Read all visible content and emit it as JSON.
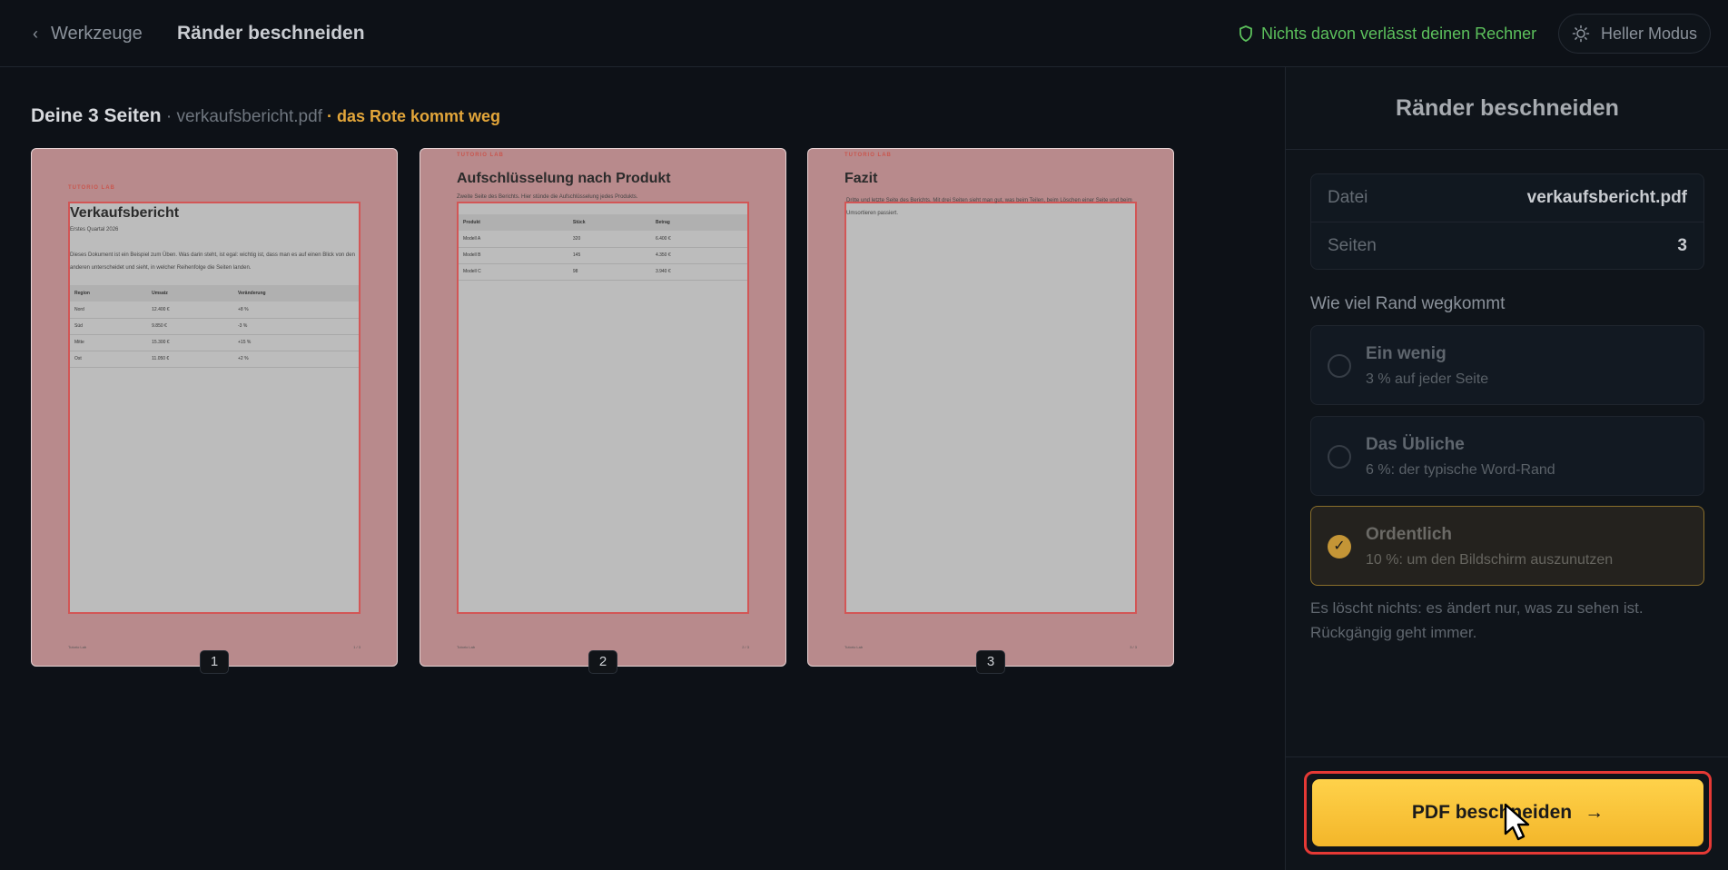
{
  "header": {
    "back_label": "Werkzeuge",
    "title": "Ränder beschneiden",
    "privacy_note": "Nichts davon verlässt deinen Rechner",
    "light_mode_label": "Heller Modus"
  },
  "pages_section": {
    "title": "Deine 3 Seiten",
    "file_part": " · verkaufsbericht.pdf",
    "warning_part": " · das Rote kommt weg"
  },
  "pages": [
    {
      "number": "1",
      "label_top": "TUTORIO LAB",
      "heading": "Verkaufsbericht",
      "sub": "Erstes Quartal 2026",
      "text": "Dieses Dokument ist ein Beispiel zum Üben. Was darin steht, ist egal: wichtig ist, dass man es auf einen Blick von den anderen unterscheidet und sieht, in welcher Reihenfolge die Seiten landen.",
      "table_headers": [
        "Region",
        "Umsatz",
        "Veränderung"
      ],
      "table_rows": [
        [
          "Nord",
          "12.400 €",
          "+8 %"
        ],
        [
          "Süd",
          "9.850 €",
          "-3 %"
        ],
        [
          "Mitte",
          "15.300 €",
          "+15 %"
        ],
        [
          "Ost",
          "11.050 €",
          "+2 %"
        ]
      ],
      "foot_left": "Tutorio Lab",
      "foot_right": "1 / 3"
    },
    {
      "number": "2",
      "label_top": "TUTORIO LAB",
      "heading": "Aufschlüsselung nach Produkt",
      "sub": "Zweite Seite des Berichts. Hier stünde die Aufschlüsselung jedes Produkts.",
      "table_headers": [
        "Produkt",
        "Stück",
        "Betrag"
      ],
      "table_rows": [
        [
          "Modell A",
          "320",
          "6.400 €"
        ],
        [
          "Modell B",
          "145",
          "4.350 €"
        ],
        [
          "Modell C",
          "98",
          "3.940 €"
        ]
      ],
      "foot_left": "Tutorio Lab",
      "foot_right": "2 / 3"
    },
    {
      "number": "3",
      "label_top": "TUTORIO LAB",
      "heading": "Fazit",
      "sub": "Dritte und letzte Seite des Berichts. Mit drei Seiten sieht man gut, was beim Teilen, beim Löschen einer Seite und beim Umsortieren passiert.",
      "foot_left": "Tutorio Lab",
      "foot_right": "3 / 3"
    }
  ],
  "panel": {
    "title": "Ränder beschneiden",
    "file_key": "Datei",
    "file_value": "verkaufsbericht.pdf",
    "pages_key": "Seiten",
    "pages_value": "3",
    "section_label": "Wie viel Rand wegkommt",
    "options": [
      {
        "title": "Ein wenig",
        "desc": "3 % auf jeder Seite",
        "selected": false
      },
      {
        "title": "Das Übliche",
        "desc": "6 %: der typische Word-Rand",
        "selected": false
      },
      {
        "title": "Ordentlich",
        "desc": "10 %: um den Bildschirm auszunutzen",
        "selected": true
      }
    ],
    "note": "Es löscht nichts: es ändert nur, was zu sehen ist. Rückgängig geht immer.",
    "cta_label": "PDF beschneiden",
    "cta_arrow": "→"
  },
  "colors": {
    "accent": "#f3b62a",
    "privacy_green": "#5cc15c",
    "crop_red": "#d25656",
    "highlight": "#e53935"
  }
}
